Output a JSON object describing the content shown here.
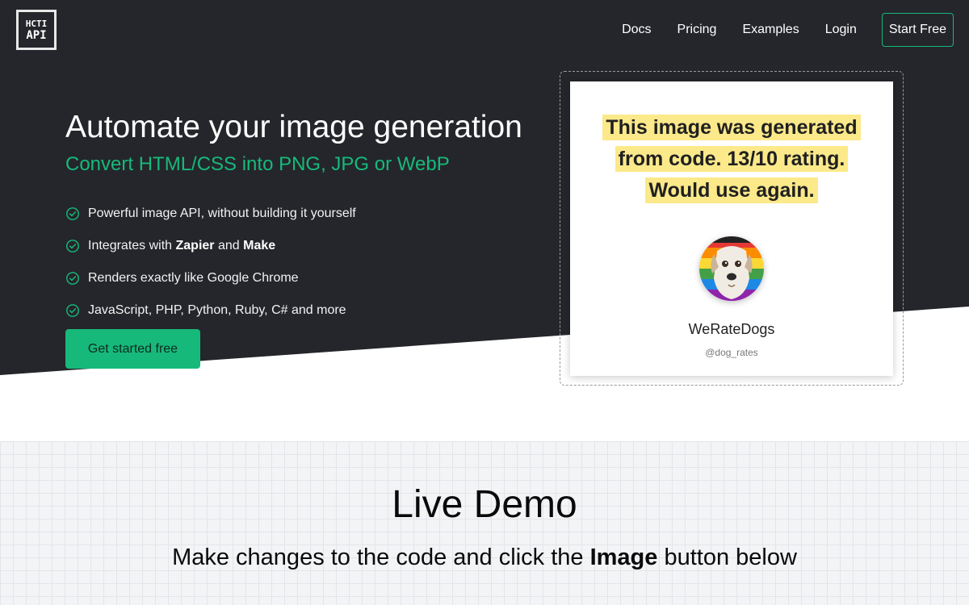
{
  "nav": {
    "logo_line1": "HCTI",
    "logo_line2": "API",
    "docs": "Docs",
    "pricing": "Pricing",
    "examples": "Examples",
    "login": "Login",
    "start_free": "Start Free"
  },
  "hero": {
    "title": "Automate your image generation",
    "subtitle": "Convert HTML/CSS into PNG, JPG or WebP",
    "features": [
      {
        "text": "Powerful image API, without building it yourself"
      },
      {
        "pre": "Integrates with ",
        "bold1": "Zapier",
        "mid": " and ",
        "bold2": "Make"
      },
      {
        "text": "Renders exactly like Google Chrome"
      },
      {
        "text": "JavaScript, PHP, Python, Ruby, C# and more"
      }
    ],
    "cta": "Get started free"
  },
  "card": {
    "quote": "This image was generated from code. 13/10 rating. Would use again.",
    "name": "WeRateDogs",
    "handle": "@dog_rates",
    "avatar_icon": "dog-avatar-icon"
  },
  "demo": {
    "title": "Live Demo",
    "subtitle_pre": "Make changes to the code and click the ",
    "subtitle_bold": "Image",
    "subtitle_post": " button below"
  },
  "colors": {
    "accent": "#17b97a",
    "dark_bg": "#24262b",
    "highlight": "#fbe98a"
  }
}
